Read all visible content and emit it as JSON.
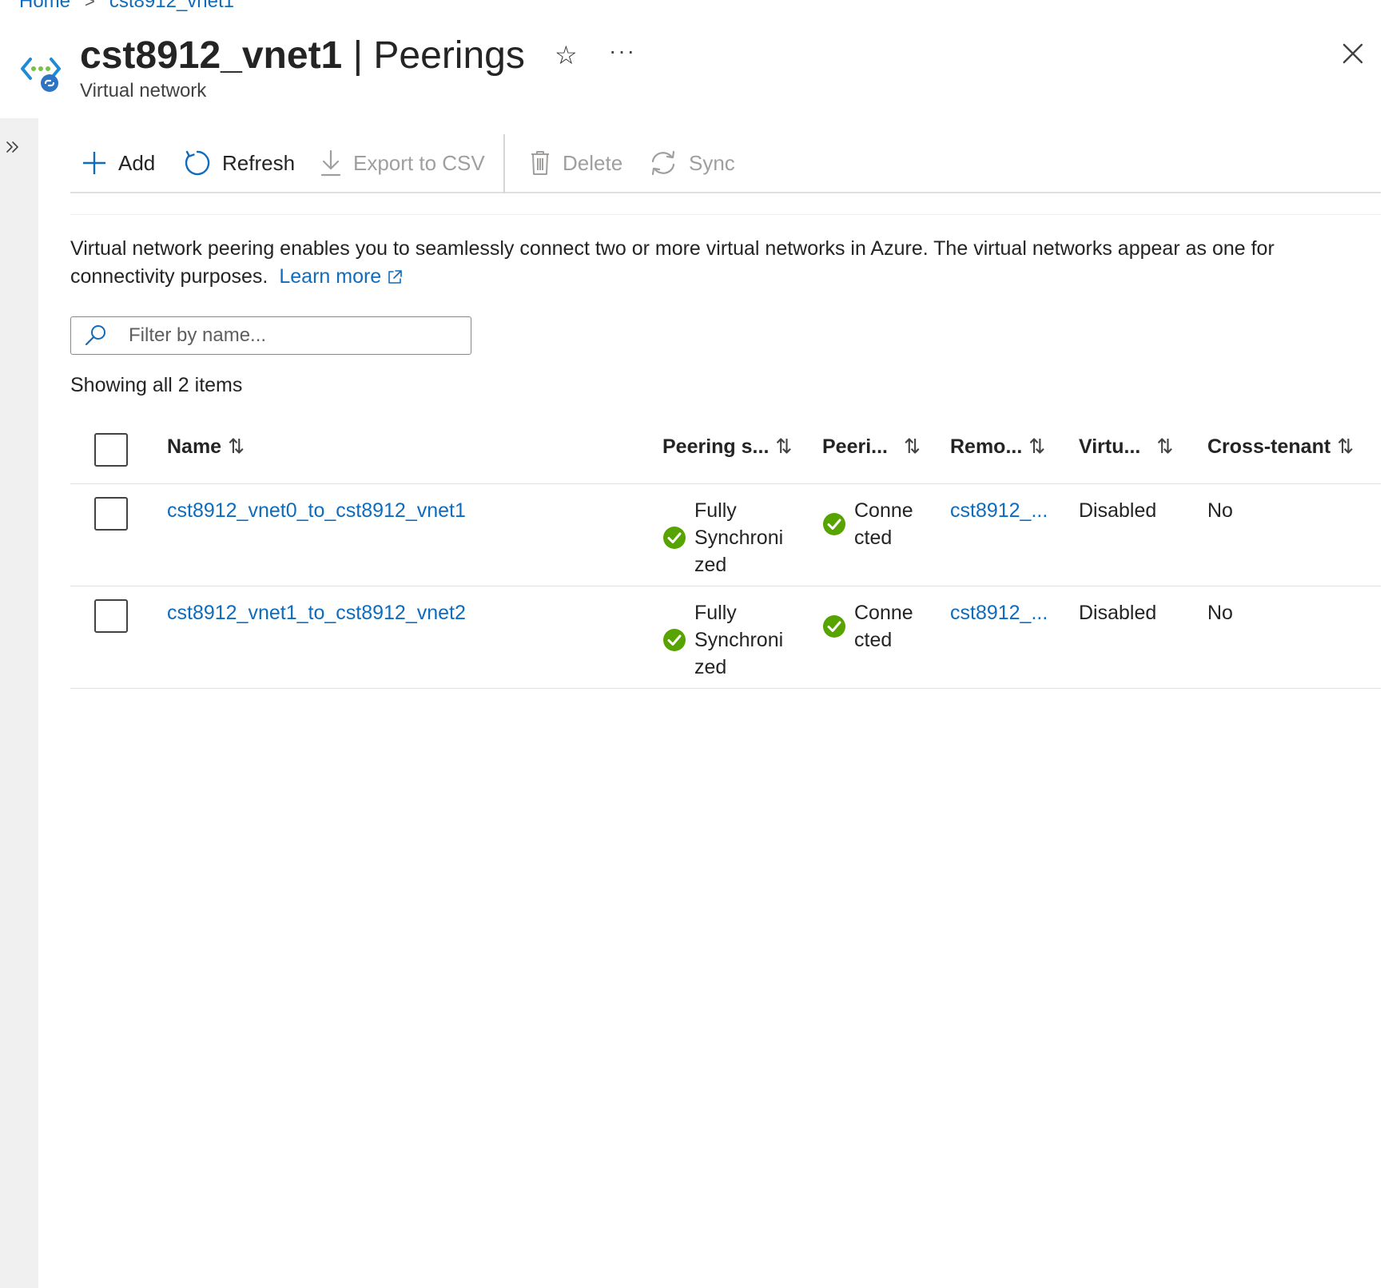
{
  "breadcrumb": {
    "home": "Home",
    "current": "cst8912_vnet1",
    "separator": ">"
  },
  "header": {
    "title_bold": "cst8912_vnet1",
    "title_separator": "|",
    "title_page": "Peerings",
    "subtitle": "Virtual network",
    "favorite_glyph": "☆",
    "more_glyph": "···"
  },
  "toolbar": {
    "add_label": "Add",
    "refresh_label": "Refresh",
    "export_label": "Export to CSV",
    "delete_label": "Delete",
    "sync_label": "Sync"
  },
  "description": {
    "text": "Virtual network peering enables you to seamlessly connect two or more virtual networks in Azure. The virtual networks appear as one for connectivity purposes.",
    "link_text": "Learn more"
  },
  "filter": {
    "placeholder": "Filter by name..."
  },
  "count_text": "Showing all 2 items",
  "table": {
    "columns": {
      "name": "Name",
      "peering_sync": "Peering s...",
      "peering_state": "Peeri...",
      "remote": "Remo...",
      "virtual": "Virtu...",
      "cross_tenant": "Cross-tenant"
    },
    "sort_glyph": "⇅",
    "rows": [
      {
        "name": "cst8912_vnet0_to_cst8912_vnet1",
        "sync_lines": [
          "Fully",
          "Synchroni",
          "zed"
        ],
        "state_lines": [
          "Conne",
          "cted"
        ],
        "remote": "cst8912_...",
        "virtual": "Disabled",
        "cross_tenant": "No"
      },
      {
        "name": "cst8912_vnet1_to_cst8912_vnet2",
        "sync_lines": [
          "Fully",
          "Synchroni",
          "zed"
        ],
        "state_lines": [
          "Conne",
          "cted"
        ],
        "remote": "cst8912_...",
        "virtual": "Disabled",
        "cross_tenant": "No"
      }
    ]
  },
  "colors": {
    "link": "#0f6cbd",
    "success": "#57a300",
    "disabled": "#a19f9d",
    "sidebar": "#f0f0f0"
  },
  "icons": {
    "resource": "virtual-network-icon",
    "expand": "chevron-double-right-icon",
    "add": "plus-icon",
    "refresh": "refresh-icon",
    "export": "download-icon",
    "delete": "trash-icon",
    "sync": "sync-icon",
    "search": "search-icon",
    "external": "external-link-icon",
    "status_ok": "success-check-icon",
    "close": "close-icon"
  }
}
